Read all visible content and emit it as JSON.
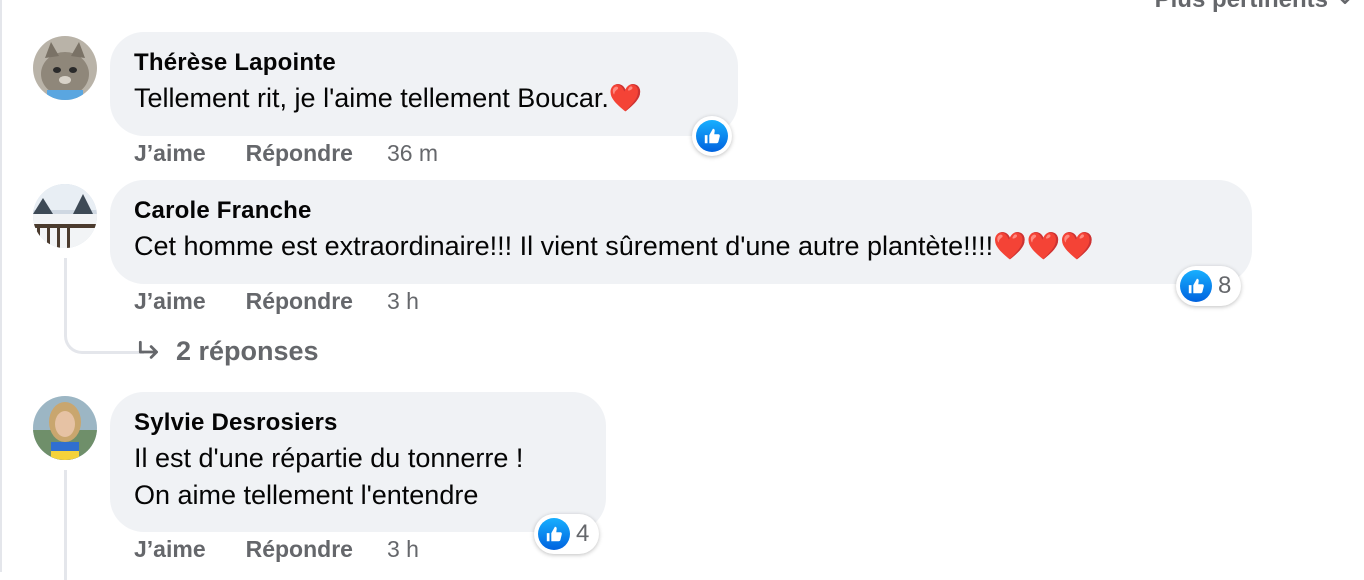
{
  "sort": {
    "label": "Plus pertinents"
  },
  "comments": [
    {
      "author": "Thérèse Lapointe",
      "text": "Tellement rit, je l'aime tellement Boucar.",
      "emoji": "❤️",
      "reaction": {
        "icon": "like-icon",
        "count": ""
      },
      "actions": {
        "like": "J’aime",
        "reply": "Répondre",
        "time": "36 m"
      }
    },
    {
      "author": "Carole Franche",
      "text": "Cet homme est extraordinaire!!! Il vient sûrement d'une autre plantète!!!!",
      "emoji": "❤️❤️❤️",
      "reaction": {
        "icon": "like-icon",
        "count": "8"
      },
      "actions": {
        "like": "J’aime",
        "reply": "Répondre",
        "time": "3 h"
      },
      "replies_label": "2 réponses"
    },
    {
      "author": "Sylvie Desrosiers",
      "text_line1": "Il est d'une répartie du tonnerre !",
      "text_line2": "On aime tellement l'entendre",
      "reaction": {
        "icon": "like-icon",
        "count": "4"
      },
      "actions": {
        "like": "J’aime",
        "reply": "Répondre",
        "time": "3 h"
      }
    }
  ],
  "colors": {
    "bubble": "#f0f2f5",
    "secondary_text": "#65676b",
    "like_blue": "#1877f2",
    "heart": "#e41e3f"
  }
}
